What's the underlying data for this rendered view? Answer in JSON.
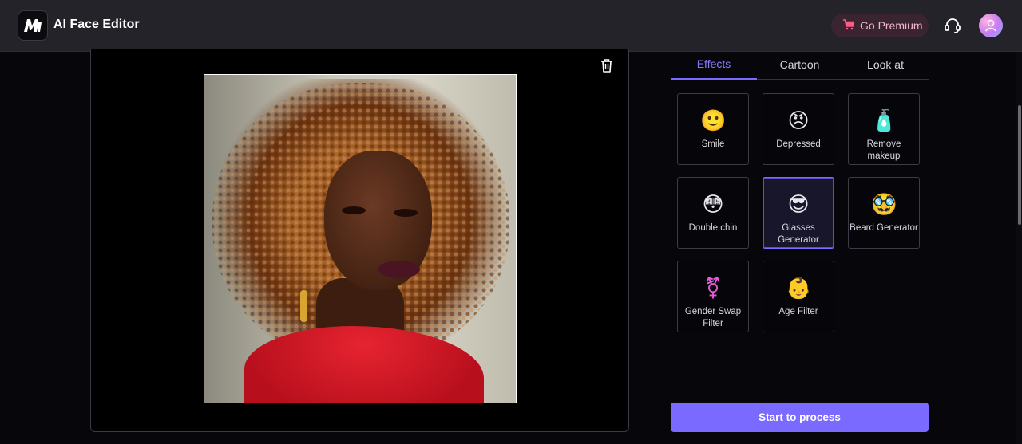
{
  "header": {
    "app_title": "AI Face Editor",
    "logo_icon": "app-logo-icon",
    "premium_label": "Go Premium",
    "premium_icon": "cart-icon",
    "support_icon": "headset-icon",
    "avatar_icon": "user-avatar-icon"
  },
  "canvas": {
    "delete_icon": "trash-icon",
    "image_description_icon": "uploaded-portrait-photo"
  },
  "tabs": [
    {
      "label": "Effects",
      "active": true
    },
    {
      "label": "Cartoon",
      "active": false
    },
    {
      "label": "Look at",
      "active": false
    }
  ],
  "effects": [
    {
      "label": "Smile",
      "icon": "smile-emoji-icon",
      "glyph": "🙂",
      "selected": false
    },
    {
      "label": "Depressed",
      "icon": "angry-emoji-icon",
      "glyph": "😠",
      "selected": false
    },
    {
      "label": "Remove makeup",
      "icon": "lotion-bottle-icon",
      "glyph": "🧴",
      "selected": false
    },
    {
      "label": "Double chin",
      "icon": "flushed-emoji-icon",
      "glyph": "😳",
      "selected": false
    },
    {
      "label": "Glasses Generator",
      "icon": "sunglasses-emoji-icon",
      "glyph": "😎",
      "selected": true
    },
    {
      "label": "Beard Generator",
      "icon": "mustache-emoji-icon",
      "glyph": "🥸",
      "selected": false
    },
    {
      "label": "Gender Swap Filter",
      "icon": "gender-symbol-icon",
      "glyph": "⚧",
      "selected": false
    },
    {
      "label": "Age Filter",
      "icon": "baby-face-icon",
      "glyph": "👶",
      "selected": false
    }
  ],
  "actions": {
    "process_label": "Start to process"
  },
  "colors": {
    "accent": "#7a6aff",
    "header_bg": "#232329",
    "premium_bg": "#3a2430",
    "premium_text": "#f0b8d0"
  }
}
